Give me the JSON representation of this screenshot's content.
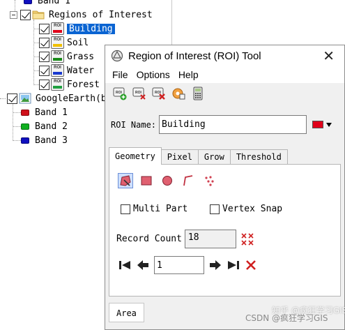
{
  "tree": {
    "top_band": "Band 1",
    "roi_folder": "Regions of Interest",
    "rois": [
      {
        "label": "Building",
        "color": "#e0001a",
        "selected": true
      },
      {
        "label": "Soil",
        "color": "#f0c000",
        "selected": false
      },
      {
        "label": "Grass",
        "color": "#1a8a1a",
        "selected": false
      },
      {
        "label": "Water",
        "color": "#1a3ad0",
        "selected": false
      },
      {
        "label": "Forest",
        "color": "#20a040",
        "selected": false
      }
    ],
    "raster_name": "GoogleEarth(b",
    "bands": [
      {
        "label": "Band 1",
        "color": "#d0101a"
      },
      {
        "label": "Band 2",
        "color": "#10b020"
      },
      {
        "label": "Band 3",
        "color": "#1010c0"
      }
    ]
  },
  "dialog": {
    "title": "Region of Interest (ROI) Tool",
    "close": "✕",
    "menu": [
      "File",
      "Options",
      "Help"
    ],
    "roi_name_label": "ROI Name:",
    "roi_name_value": "Building",
    "roi_color": "#e0001a",
    "tabs": [
      "Geometry",
      "Pixel",
      "Grow",
      "Threshold"
    ],
    "active_tab": "Geometry",
    "multi_part_label": "Multi Part",
    "vertex_snap_label": "Vertex Snap",
    "record_count_label": "Record Count",
    "record_count_value": "18",
    "record_index": "1",
    "bottom_tab": "Area"
  },
  "watermark": {
    "line1": "知乎 @疯狂学习GIS",
    "line2": "CSDN @疯狂学习GIS"
  }
}
